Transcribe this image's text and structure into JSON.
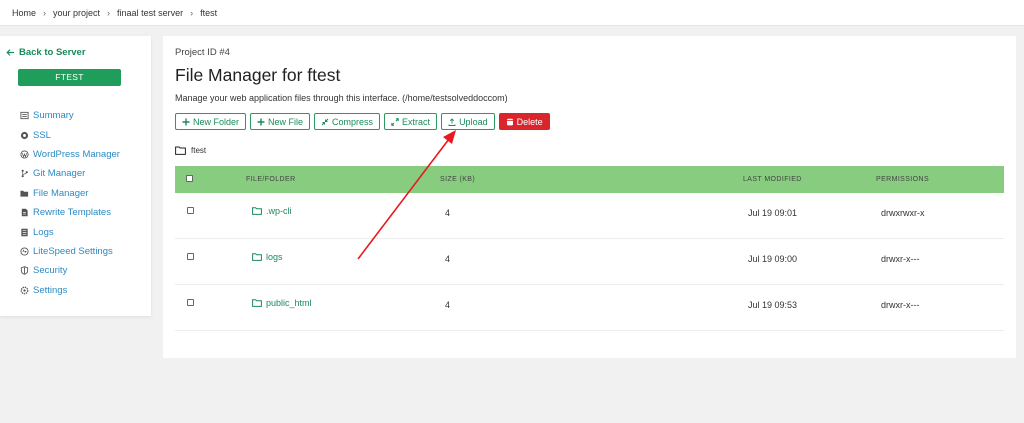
{
  "breadcrumb": [
    "Home",
    "your project",
    "finaal test server",
    "ftest"
  ],
  "sidebar": {
    "back_label": "Back to Server",
    "server_button": "FTEST",
    "items": [
      {
        "label": "Summary",
        "icon": "summary-icon"
      },
      {
        "label": "SSL",
        "icon": "ssl-icon"
      },
      {
        "label": "WordPress Manager",
        "icon": "wordpress-icon"
      },
      {
        "label": "Git Manager",
        "icon": "git-icon"
      },
      {
        "label": "File Manager",
        "icon": "folder-open-icon"
      },
      {
        "label": "Rewrite Templates",
        "icon": "rewrite-icon"
      },
      {
        "label": "Logs",
        "icon": "logs-icon"
      },
      {
        "label": "LiteSpeed Settings",
        "icon": "litespeed-icon"
      },
      {
        "label": "Security",
        "icon": "security-icon"
      },
      {
        "label": "Settings",
        "icon": "settings-icon"
      }
    ]
  },
  "main": {
    "project_id": "Project ID #4",
    "title": "File Manager for ftest",
    "description": "Manage your web application files through this interface. (/home/testsolveddoccom)",
    "toolbar": {
      "new_folder": "New Folder",
      "new_file": "New File",
      "compress": "Compress",
      "extract": "Extract",
      "upload": "Upload",
      "delete": "Delete"
    },
    "current_path": "ftest",
    "table": {
      "headers": {
        "name": "FILE/FOLDER",
        "size": "SIZE (KB)",
        "modified": "LAST MODIFIED",
        "permissions": "PERMISSIONS"
      },
      "rows": [
        {
          "name": ".wp-cli",
          "size": "4",
          "modified": "Jul 19 09:01",
          "permissions": "drwxrwxr-x"
        },
        {
          "name": "logs",
          "size": "4",
          "modified": "Jul 19 09:00",
          "permissions": "drwxr-x---"
        },
        {
          "name": "public_html",
          "size": "4",
          "modified": "Jul 19 09:53",
          "permissions": "drwxr-x---"
        }
      ]
    }
  },
  "colors": {
    "accent": "#1e9e5a",
    "link": "#2a8ac4",
    "table_header": "#88cc80",
    "danger": "#d9262d",
    "annotation": "#e8191f"
  }
}
